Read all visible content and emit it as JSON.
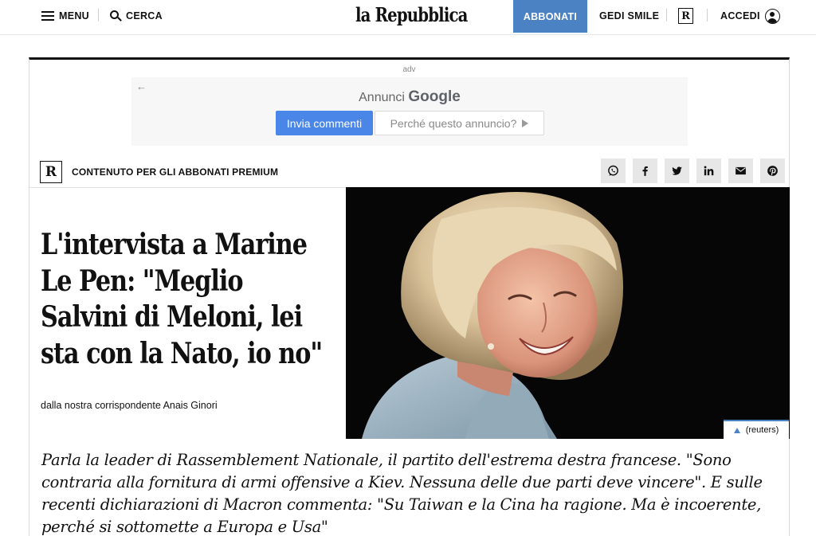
{
  "header": {
    "menu_label": "MENU",
    "search_label": "CERCA",
    "logo_text": "la Repubblica",
    "subscribe_label": "ABBONATI",
    "gedi_label": "GEDI SMILE",
    "r_badge": "R",
    "login_label": "ACCEDI",
    "subscribe_color": "#4b82c3"
  },
  "ad": {
    "label": "adv",
    "back_icon": "←",
    "title_prefix": "Annunci",
    "title_brand": "Google",
    "send_feedback": "Invia commenti",
    "why_ad": "Perché questo annuncio?"
  },
  "premium": {
    "badge": "R",
    "label": "CONTENUTO PER GLI ABBONATI PREMIUM",
    "share_icons": [
      "whatsapp-icon",
      "facebook-icon",
      "twitter-icon",
      "linkedin-icon",
      "email-icon",
      "pinterest-icon"
    ]
  },
  "article": {
    "headline": "L'intervista a Marine Le Pen: \"Meglio Salvini di Meloni, lei sta con la Nato, io no\"",
    "byline": "dalla nostra corrispondente Anais Ginori",
    "photo_credit": "(reuters)",
    "summary": "Parla la leader di Rassemblement Nationale, il partito dell'estrema destra francese. \"Sono contraria alla fornitura di armi offensive a Kiev. Nessuna delle due parti deve vincere\". E sulle recenti dichiarazioni di Macron commenta: \"Su Taiwan e la Cina ha ragione. Ma è incoerente, perché si sottomette a Europa e Usa\""
  }
}
